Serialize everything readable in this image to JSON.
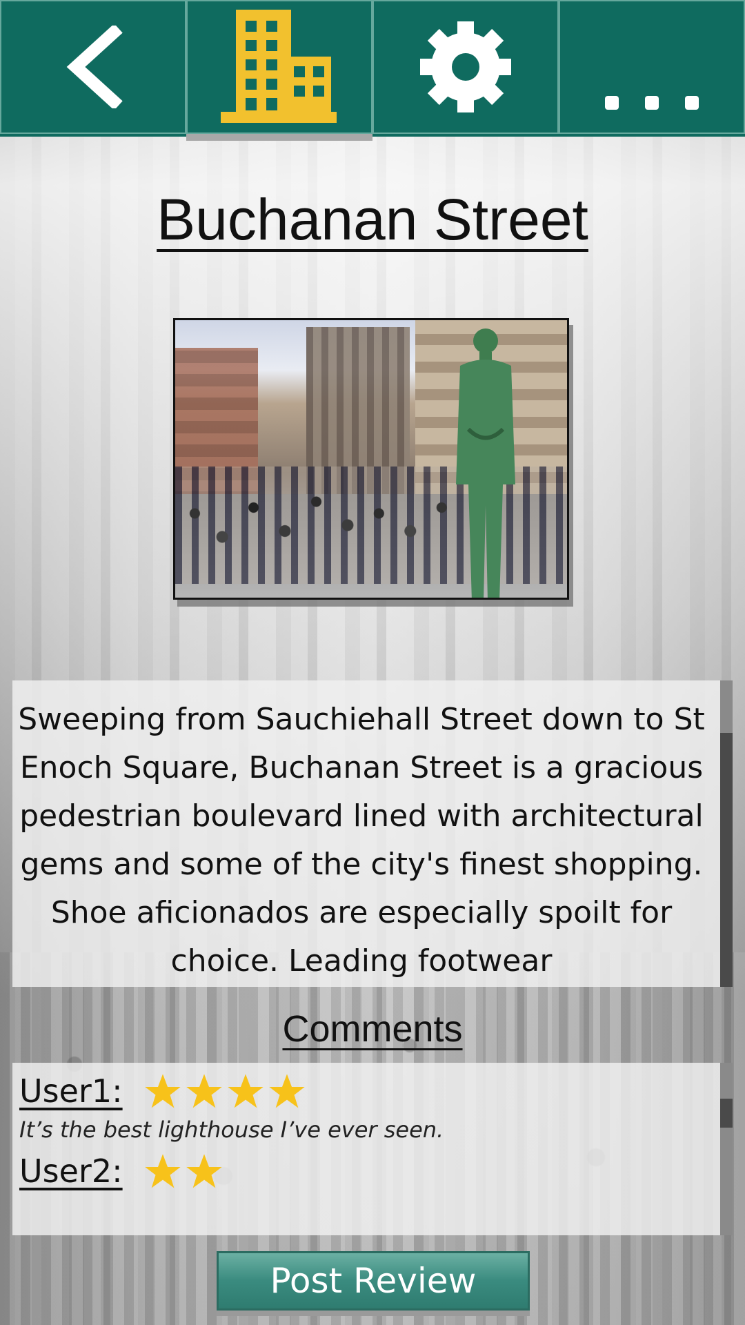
{
  "nav": {
    "tabs": [
      {
        "icon": "back-arrow-icon"
      },
      {
        "icon": "building-icon",
        "active": true
      },
      {
        "icon": "gear-icon"
      },
      {
        "icon": "more-dots-icon"
      }
    ],
    "bar_color": "#0f6b5f",
    "active_icon_color": "#f2c12e"
  },
  "place": {
    "title": "Buchanan Street",
    "description": "Sweeping from Sauchiehall Street down to St Enoch Square, Buchanan Street is a gracious pedestrian boulevard lined with architectural gems and some of the city's finest shopping. Shoe aficionados are especially spoilt for choice. Leading footwear"
  },
  "comments": {
    "heading": "Comments",
    "items": [
      {
        "user": "User1:",
        "rating": 4,
        "text": "It’s the best lighthouse I’ve ever seen."
      },
      {
        "user": "User2:",
        "rating": 2,
        "text": ""
      }
    ]
  },
  "actions": {
    "post_review_label": "Post Review"
  },
  "colors": {
    "star": "#f7c21a",
    "button": "#3a8b7f"
  }
}
